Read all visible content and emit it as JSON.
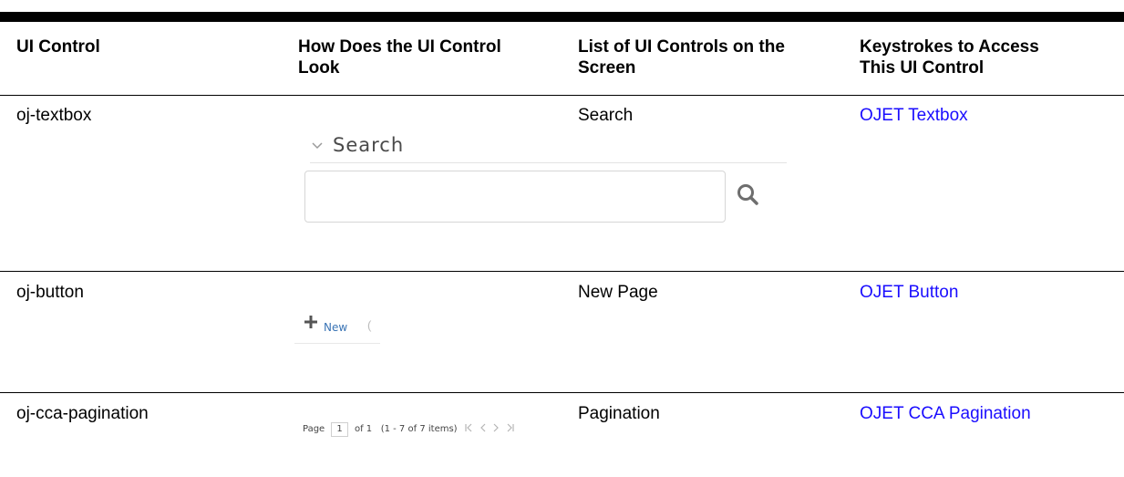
{
  "table": {
    "headers": {
      "col1": "UI Control",
      "col2_line1": "How Does the UI Control",
      "col2_line2": "Look",
      "col3_line1": "List of UI Controls on the",
      "col3_line2": "Screen",
      "col4_line1": "Keystrokes to Access",
      "col4_line2": "This UI Control"
    },
    "rows": [
      {
        "control": "oj-textbox",
        "list": "Search",
        "link": "OJET Textbox"
      },
      {
        "control": "oj-button",
        "list": "New Page",
        "link": "OJET Button"
      },
      {
        "control": "oj-cca-pagination",
        "list": "Pagination",
        "link": "OJET CCA Pagination"
      }
    ]
  },
  "search_widget": {
    "title": "Search",
    "icon": "search-icon",
    "collapse_icon": "chevron-down-icon"
  },
  "new_button": {
    "label": "New",
    "icon": "plus-icon",
    "fragment": "("
  },
  "pagination": {
    "page_label": "Page",
    "current_page": "1",
    "of_label": "of 1",
    "range_label": "(1 - 7 of",
    "total": "7",
    "items_label": "items)",
    "first_icon": "first-page-icon",
    "prev_icon": "previous-page-icon",
    "next_icon": "next-page-icon",
    "last_icon": "last-page-icon"
  },
  "colors": {
    "link": "#1a0dff",
    "accent_blue": "#3a74b5"
  }
}
